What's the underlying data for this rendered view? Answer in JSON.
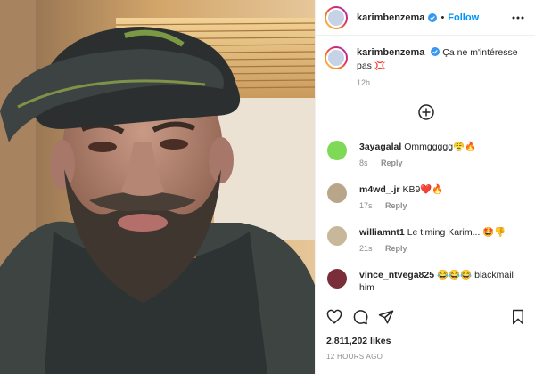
{
  "header": {
    "username": "karimbenzema",
    "follow_label": "Follow",
    "separator": "•"
  },
  "caption": {
    "username": "karimbenzema",
    "text": "Ça ne m'intéresse pas 💢",
    "time": "12h"
  },
  "comments": [
    {
      "username": "3ayagalal",
      "text": "Ommggggg😤🔥",
      "time": "8s",
      "reply": "Reply",
      "avatar_color": "#7ed957"
    },
    {
      "username": "m4wd_.jr",
      "text": "KB9❤️🔥",
      "time": "17s",
      "reply": "Reply",
      "avatar_color": "#b9a58a"
    },
    {
      "username": "williamnt1",
      "text": "Le timing Karim... 🤩👎",
      "time": "21s",
      "reply": "Reply",
      "avatar_color": "#c8b89a"
    },
    {
      "username": "vince_ntvega825",
      "text": "😂😂😂 blackmail him",
      "time": "",
      "reply": "",
      "avatar_color": "#7a2e3a"
    }
  ],
  "footer": {
    "likes": "2,811,202 likes",
    "posted": "12 HOURS AGO"
  },
  "colors": {
    "accent": "#0095f6",
    "verified": "#3897f0",
    "muted": "#8e8e8e"
  },
  "icons": [
    "more-icon",
    "verified-icon",
    "add-comments-icon",
    "heart-icon",
    "comment-icon",
    "share-icon",
    "bookmark-icon"
  ]
}
